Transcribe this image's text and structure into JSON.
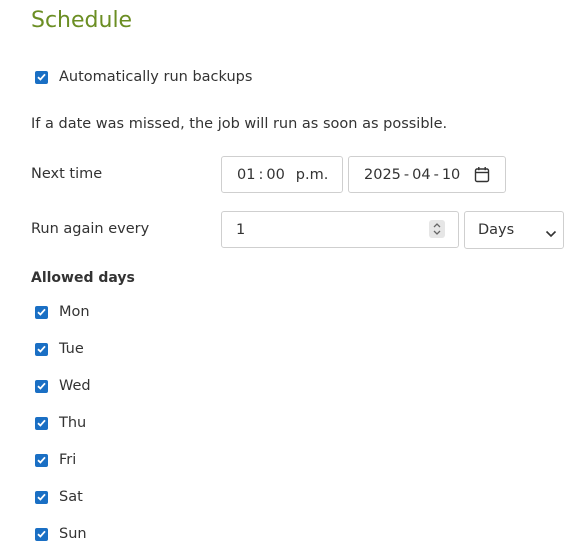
{
  "title": "Schedule",
  "auto_backup": {
    "label": "Automatically run backups",
    "checked": true
  },
  "note": "If a date was missed, the job will run as soon as possible.",
  "next_time": {
    "label": "Next time",
    "hour": "01",
    "minute": "00",
    "ampm": "p.m.",
    "year": "2025",
    "month": "04",
    "day": "10",
    "time_separator": ":",
    "date_separator": "-"
  },
  "run_again": {
    "label": "Run again every",
    "value": "1",
    "unit": "Days"
  },
  "allowed_days": {
    "label": "Allowed days",
    "days": [
      {
        "label": "Mon",
        "checked": true
      },
      {
        "label": "Tue",
        "checked": true
      },
      {
        "label": "Wed",
        "checked": true
      },
      {
        "label": "Thu",
        "checked": true
      },
      {
        "label": "Fri",
        "checked": true
      },
      {
        "label": "Sat",
        "checked": true
      },
      {
        "label": "Sun",
        "checked": true
      }
    ]
  },
  "colors": {
    "title": "#6b8e23",
    "checkbox": "#1a6fc4",
    "text": "#333333",
    "border": "#cfcfcf"
  }
}
